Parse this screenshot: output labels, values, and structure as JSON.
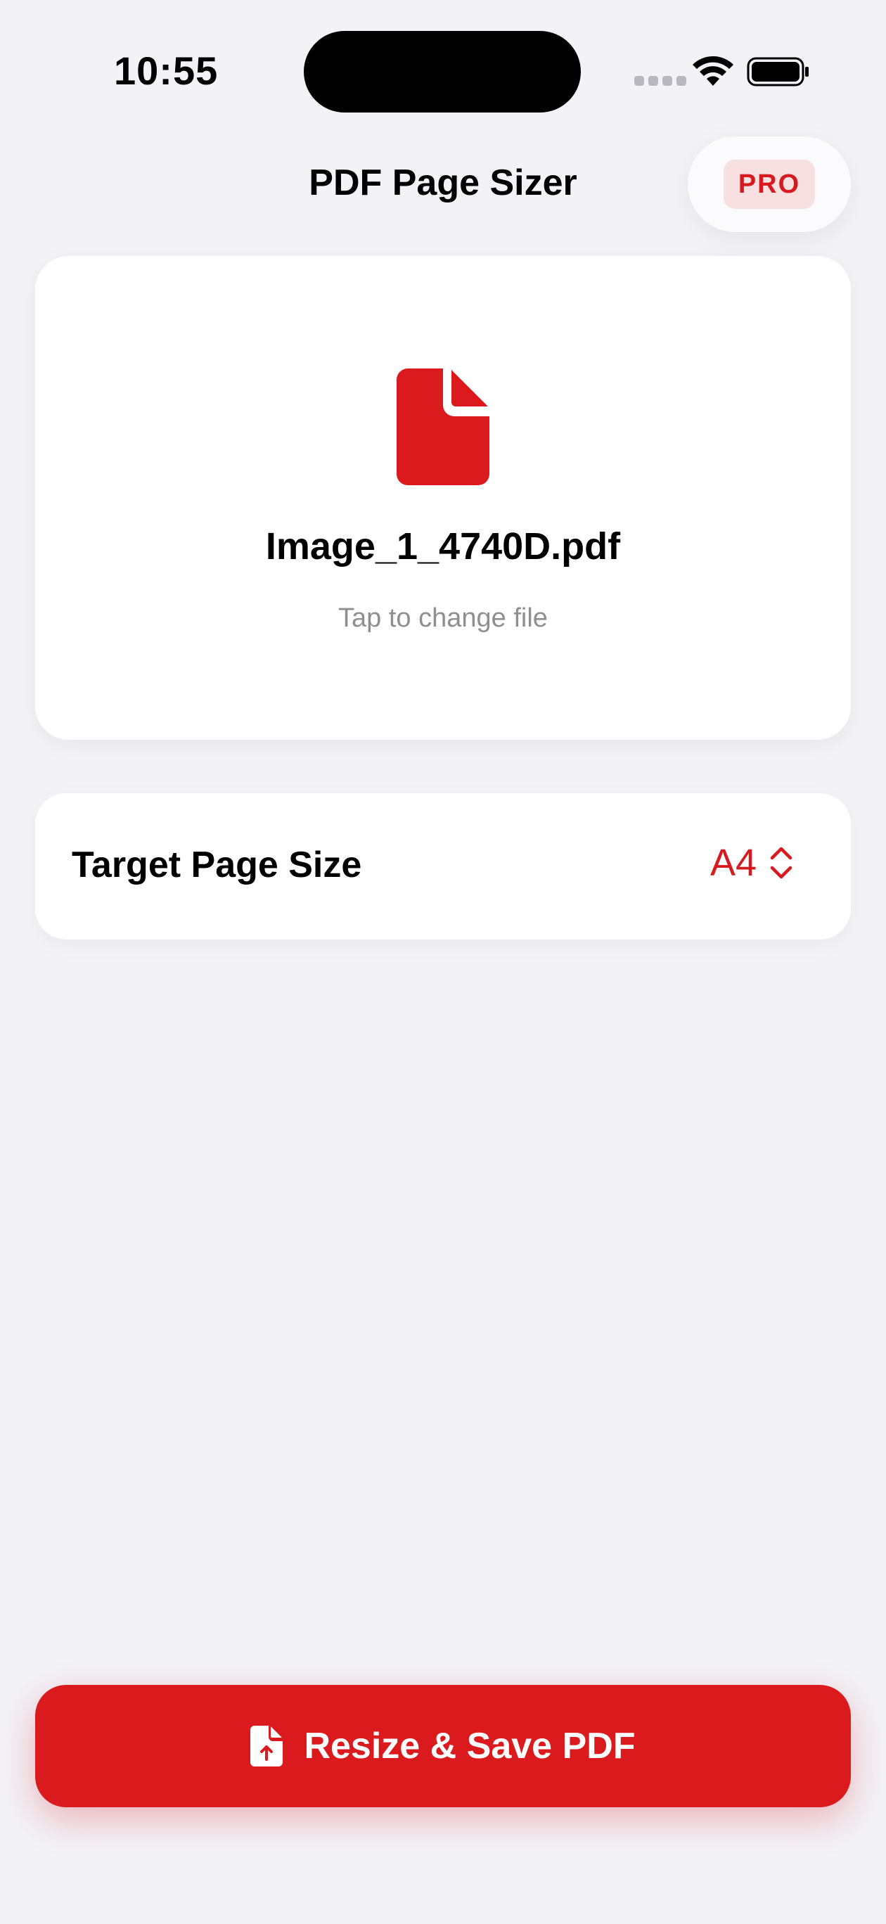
{
  "status_bar": {
    "time": "10:55"
  },
  "nav": {
    "title": "PDF Page Sizer",
    "pro_badge": "PRO"
  },
  "file_card": {
    "file_name": "Image_1_4740D.pdf",
    "hint": "Tap to change file",
    "icon": "document-icon"
  },
  "page_size": {
    "label": "Target Page Size",
    "selected": "A4",
    "icon": "chevron-updown-icon"
  },
  "primary_action": {
    "label": "Resize & Save PDF",
    "icon": "document-upload-icon"
  },
  "colors": {
    "accent": "#db1a1e",
    "background": "#f2f2f7",
    "pro_badge_bg": "#f8dfe0",
    "secondary_text": "#8e8e93"
  }
}
